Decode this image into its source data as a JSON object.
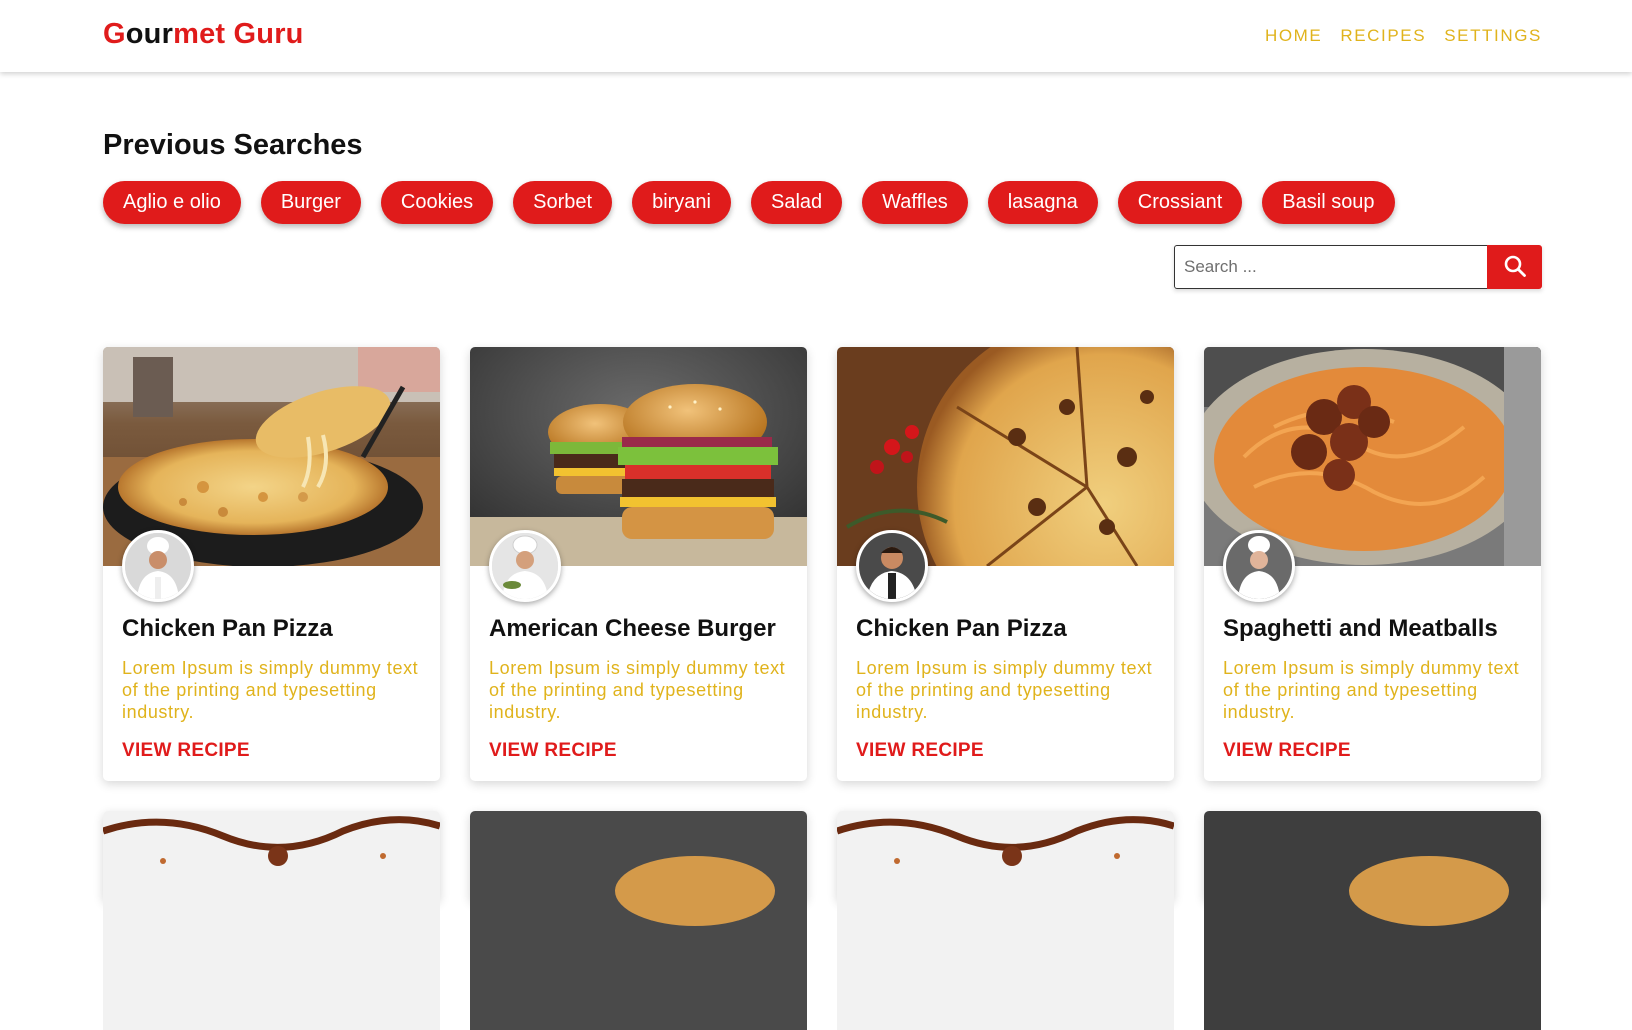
{
  "brand": {
    "title": "Gourmet Guru",
    "parts": [
      "G",
      "our",
      "met",
      " Guru"
    ]
  },
  "nav": {
    "items": [
      "HOME",
      "RECIPES",
      "SETTINGS"
    ]
  },
  "previous_searches": {
    "title": "Previous Searches",
    "items": [
      "Aglio e olio",
      "Burger",
      "Cookies",
      "Sorbet",
      "biryani",
      "Salad",
      "Waffles",
      "lasagna",
      "Crossiant",
      "Basil soup"
    ]
  },
  "search": {
    "placeholder": "Search ...",
    "value": ""
  },
  "cards": [
    {
      "title": "Chicken Pan Pizza",
      "description": "Lorem Ipsum is simply dummy text of the printing and typesetting industry.",
      "link": "VIEW RECIPE",
      "image": "pizza-pan-photo",
      "avatar": "chef-avatar"
    },
    {
      "title": "American Cheese Burger",
      "description": "Lorem Ipsum is simply dummy text of the printing and typesetting industry.",
      "link": "VIEW RECIPE",
      "image": "burger-photo",
      "avatar": "chef-avatar"
    },
    {
      "title": "Chicken Pan Pizza",
      "description": "Lorem Ipsum is simply dummy text of the printing and typesetting industry.",
      "link": "VIEW RECIPE",
      "image": "pizza-top-photo",
      "avatar": "chef-avatar"
    },
    {
      "title": "Spaghetti and Meatballs",
      "description": "Lorem Ipsum is simply dummy text of the printing and typesetting industry.",
      "link": "VIEW RECIPE",
      "image": "spaghetti-photo",
      "avatar": "chef-avatar"
    }
  ],
  "colors": {
    "accent_red": "#e01b1b",
    "accent_gold": "#e0b31c",
    "text_dark": "#111111"
  },
  "icons": {
    "search": "search-icon"
  }
}
